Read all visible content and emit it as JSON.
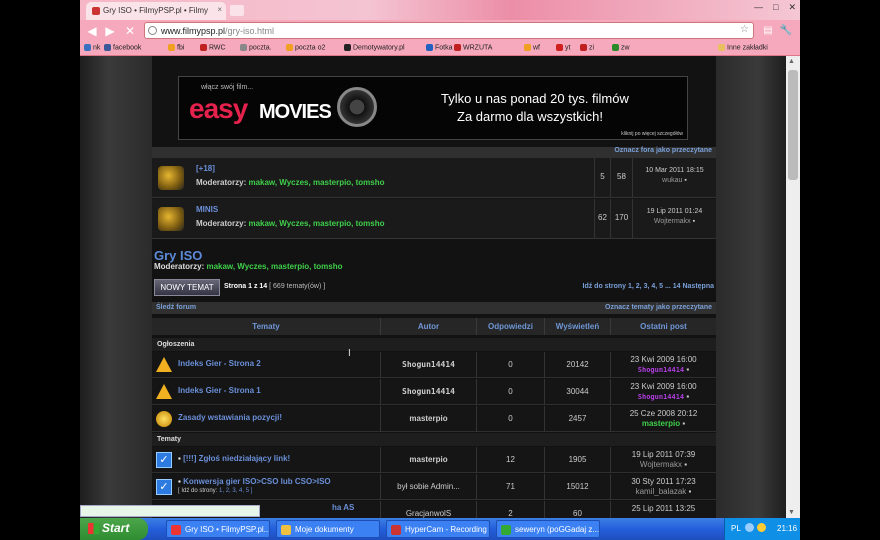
{
  "browser": {
    "tab_title": "Gry ISO • FilmyPSP.pl • Filmy",
    "url_domain": "www.filmypsp.pl",
    "url_path": "/gry-iso.html",
    "bookmarks": [
      {
        "label": "nk",
        "color": "#3a70c0"
      },
      {
        "label": "facebook",
        "color": "#3b5998"
      },
      {
        "label": "fbi",
        "color": "#f0a020"
      },
      {
        "label": "RWC",
        "color": "#c02020"
      },
      {
        "label": "poczta.",
        "color": "#888888"
      },
      {
        "label": "poczta o2",
        "color": "#f0a020"
      },
      {
        "label": "Demotywatory.pl",
        "color": "#222222"
      },
      {
        "label": "Fotka",
        "color": "#2060c0"
      },
      {
        "label": "WRZUTA",
        "color": "#c02020"
      },
      {
        "label": "wf",
        "color": "#f0a020"
      },
      {
        "label": "yt",
        "color": "#d02020"
      },
      {
        "label": "zi",
        "color": "#c02020"
      },
      {
        "label": "zw",
        "color": "#2a8a2a"
      }
    ],
    "other_bookmarks": "Inne zakładki"
  },
  "banner": {
    "small": "włącz swój film...",
    "easy": "easy",
    "movies": "MOVIES",
    "line1": "Tylko u nas ponad 20 tys. filmów",
    "line2": "Za darmo dla wszystkich!",
    "click": "kliknij po więcej szczegółów"
  },
  "mark_forums_read": "Oznacz fora jako przeczytane",
  "forums": [
    {
      "name": "[+18]",
      "mods_label": "Moderatorzy:",
      "mods": "makaw, Wyczes, masterpio, tomsho",
      "topics": "5",
      "posts": "58",
      "last_date": "10 Mar 2011 18:15",
      "last_user": "wukau"
    },
    {
      "name": "MINIS",
      "mods_label": "Moderatorzy:",
      "mods": "makaw, Wyczes, masterpio, tomsho",
      "topics": "62",
      "posts": "170",
      "last_date": "19 Lip 2011 01:24",
      "last_user": "Wojtermakx"
    }
  ],
  "section": {
    "title": "Gry ISO",
    "mods_label": "Moderatorzy:",
    "mods": "makaw, Wyczes, masterpio, tomsho",
    "new_topic": "NOWY TEMAT",
    "page_label": "Strona 1 z 14",
    "topics_count": "[ 669 tematy(ów) ]",
    "pager": "Idź do strony 1, 2, 3, 4, 5 ... 14 Następna",
    "watch": "Śledź forum",
    "mark_topics_read": "Oznacz tematy jako przeczytane"
  },
  "table": {
    "headers": [
      "Tematy",
      "Autor",
      "Odpowiedzi",
      "Wyświetleń",
      "Ostatni post"
    ],
    "sec_announcements": "Ogłoszenia",
    "sec_topics": "Tematy",
    "announcements": [
      {
        "icon": "warning",
        "title": "Indeks Gier - Strona 2",
        "author": "Shogun14414",
        "author_style": "purple",
        "replies": "0",
        "views": "20142",
        "last_date": "23 Kwi 2009 16:00",
        "last_user": "Shogun14414"
      },
      {
        "icon": "warning",
        "title": "Indeks Gier - Strona 1",
        "author": "Shogun14414",
        "author_style": "purple",
        "replies": "0",
        "views": "30044",
        "last_date": "23 Kwi 2009 16:00",
        "last_user": "Shogun14414"
      },
      {
        "icon": "coin",
        "title": "Zasady wstawiania pozycji!",
        "author": "masterpio",
        "author_style": "green",
        "replies": "0",
        "views": "2457",
        "last_date": "25 Cze 2008 20:12",
        "last_user": "masterpio"
      }
    ],
    "topics": [
      {
        "title": "[!!!] Zgłoś niedziałający link!",
        "sub": "",
        "author": "masterpio",
        "author_style": "green",
        "replies": "12",
        "views": "1905",
        "last_date": "19 Lip 2011 07:39",
        "last_user": "Wojtermakx"
      },
      {
        "title": "Konwersja gier ISO>CSO lub CSO>ISO",
        "sub_label": "[ Idź do strony:",
        "sub_pages": "1, 2, 3, 4, 5 ]",
        "author": "był sobie Admin...",
        "author_style": "grey",
        "replies": "71",
        "views": "15012",
        "last_date": "30 Sty 2011 17:23",
        "last_user": "kamil_balazak"
      },
      {
        "title": "ha AS",
        "sub": "",
        "author": "GracjanwolS",
        "author_style": "grey",
        "replies": "2",
        "views": "60",
        "last_date": "25 Lip 2011 13:25",
        "last_user": ""
      }
    ]
  },
  "taskbar": {
    "start": "Start",
    "tasks": [
      {
        "label": "Gry ISO • FilmyPSP.pl...",
        "color": "#e33"
      },
      {
        "label": "Moje dokumenty",
        "color": "#f0c040"
      },
      {
        "label": "HyperCam - Recording",
        "color": "#c33"
      },
      {
        "label": "seweryn (poGGadaj z...",
        "color": "#3a3"
      }
    ],
    "lang": "PL",
    "time": "21:16"
  }
}
